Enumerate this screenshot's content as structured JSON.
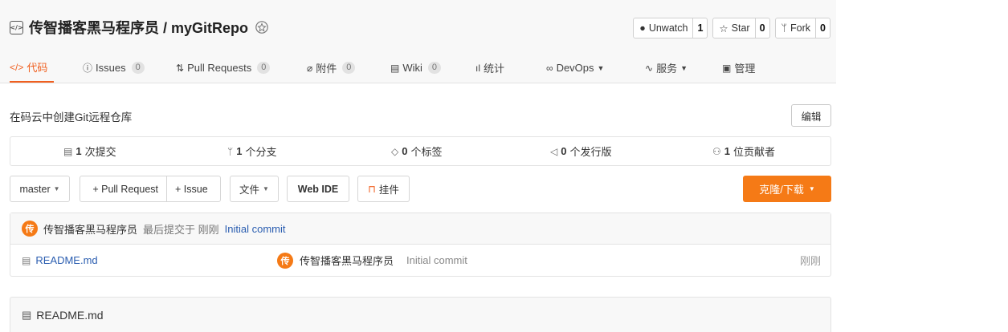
{
  "repo": {
    "title": "传智播客黑马程序员 / myGitRepo"
  },
  "actions": [
    {
      "label": "Unwatch",
      "count": "1",
      "icon": "eye-icon"
    },
    {
      "label": "Star",
      "count": "0",
      "icon": "star-icon"
    },
    {
      "label": "Fork",
      "count": "0",
      "icon": "fork-icon"
    }
  ],
  "tabs": [
    {
      "label": "代码",
      "icon": "code-icon"
    },
    {
      "label": "Issues",
      "count": "0",
      "icon": "issue-icon"
    },
    {
      "label": "Pull Requests",
      "count": "0",
      "icon": "pull-request-icon"
    },
    {
      "label": "附件",
      "count": "0",
      "icon": "attachment-icon"
    },
    {
      "label": "Wiki",
      "count": "0",
      "icon": "wiki-icon"
    },
    {
      "label": "统计",
      "icon": "stats-icon"
    },
    {
      "label": "DevOps",
      "icon": "devops-icon"
    },
    {
      "label": "服务",
      "icon": "service-icon"
    },
    {
      "label": "管理",
      "icon": "manage-icon"
    }
  ],
  "description": "在码云中创建Git远程仓库",
  "edit_label": "编辑",
  "stats": [
    {
      "count": "1",
      "label": "次提交",
      "icon": "commit-icon"
    },
    {
      "count": "1",
      "label": "个分支",
      "icon": "branch-icon"
    },
    {
      "count": "0",
      "label": "个标签",
      "icon": "tag-icon"
    },
    {
      "count": "0",
      "label": "个发行版",
      "icon": "release-icon"
    },
    {
      "count": "1",
      "label": "位贡献者",
      "icon": "contributor-icon"
    }
  ],
  "toolbar": {
    "branch": "master",
    "pull_request": "+ Pull Request",
    "issue": "+ Issue",
    "file": "文件",
    "web_ide": "Web IDE",
    "mount": "挂件",
    "clone": "克隆/下载"
  },
  "last_commit": {
    "avatar": "传",
    "author": "传智播客黑马程序员",
    "meta": "最后提交于 刚刚",
    "message": "Initial commit"
  },
  "files": [
    {
      "name": "README.md",
      "avatar": "传",
      "author": "传智播客黑马程序员",
      "message": "Initial commit",
      "time": "刚刚"
    }
  ],
  "readme": {
    "title": "README.md"
  },
  "colors": {
    "accent": "#f05f1f",
    "clone_button": "#f57a16",
    "link": "#2a5db0"
  }
}
